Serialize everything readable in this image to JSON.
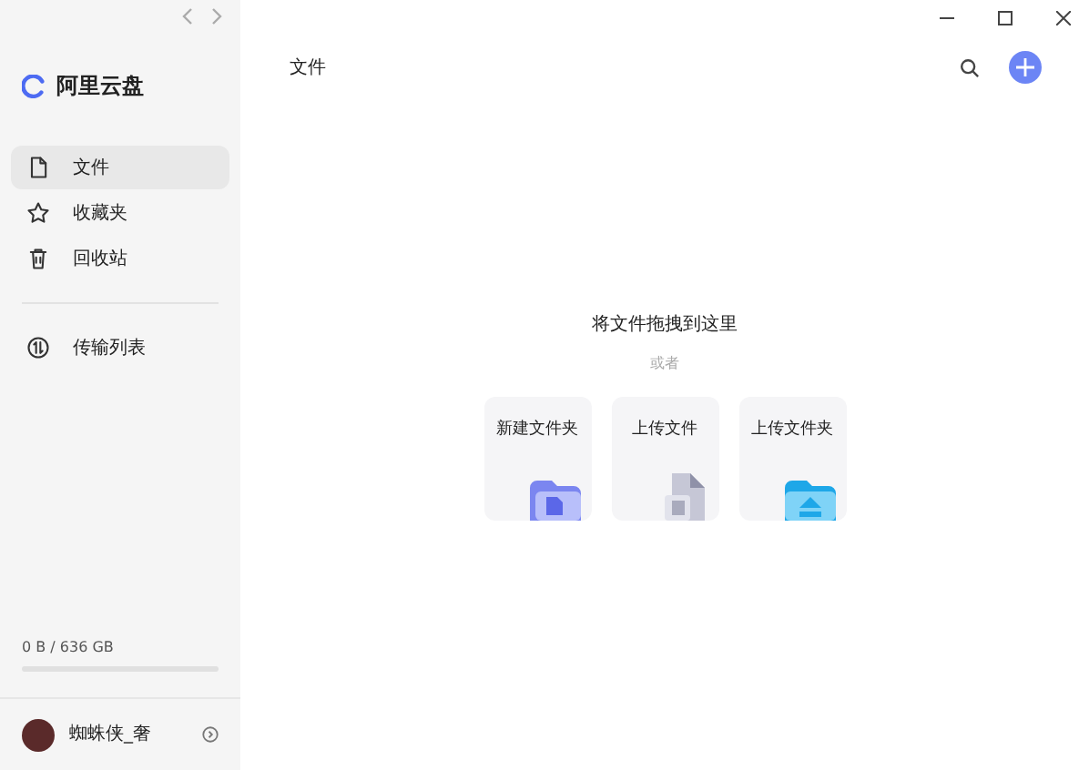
{
  "app": {
    "name": "阿里云盘"
  },
  "sidebar": {
    "items": [
      {
        "label": "文件",
        "kind": "file",
        "selected": true
      },
      {
        "label": "收藏夹",
        "kind": "star",
        "selected": false
      },
      {
        "label": "回收站",
        "kind": "trash",
        "selected": false
      }
    ],
    "transfer": {
      "label": "传输列表",
      "kind": "transfer",
      "selected": false
    },
    "storage": {
      "text": "0 B / 636 GB",
      "level": 0
    },
    "user": {
      "name": "蜘蛛侠_奢"
    }
  },
  "main": {
    "title": "文件",
    "drop_hint": "将文件拖拽到这里",
    "or": "或者",
    "actions": [
      {
        "label": "新建文件夹",
        "kind": "folder"
      },
      {
        "label": "上传文件",
        "kind": "file"
      },
      {
        "label": "上传文件夹",
        "kind": "upload"
      }
    ]
  }
}
